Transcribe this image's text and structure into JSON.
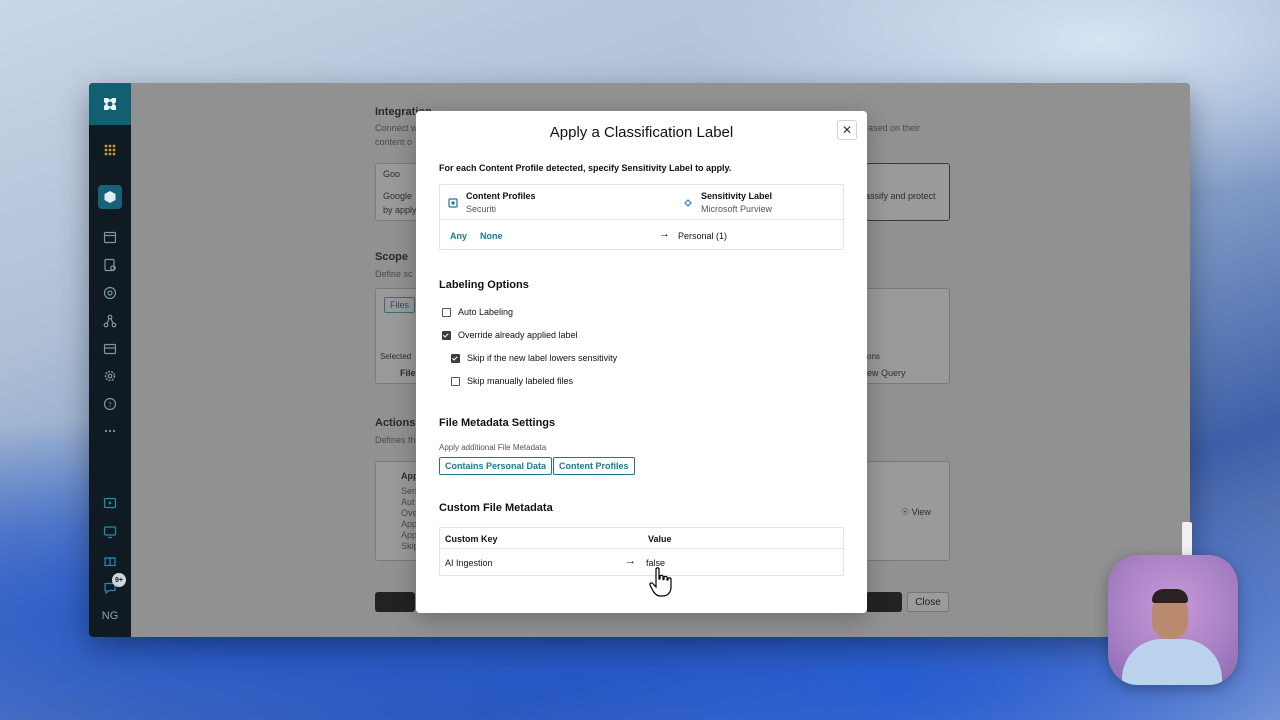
{
  "background": {
    "rail": {
      "avatar": "NG",
      "badge": "9+"
    },
    "integration": {
      "title": "Integration",
      "sub1": "Connect w",
      "sub2": "content o",
      "sub_right": "ased on their",
      "card_title": "Goo",
      "card_line1": "Google",
      "card_line2": "by apply",
      "card_right": "assify and protect"
    },
    "scope": {
      "title": "Scope",
      "sub": "Define sc",
      "chip": "Files",
      "selected": "Selected",
      "file": "File",
      "right_label": "tions",
      "view_query": "iew Query"
    },
    "actions": {
      "title": "Actions",
      "sub": "Defines th",
      "card_title": "App",
      "lines": [
        "Sen",
        "Aut",
        "Ove",
        "App",
        "App",
        "Skip"
      ],
      "view": "View"
    },
    "close_label": "Close"
  },
  "modal": {
    "title": "Apply a Classification Label",
    "intro": "For each Content Profile detected, specify Sensitivity Label to apply.",
    "mapping": {
      "left_header": "Content Profiles",
      "left_sub": "Securiti",
      "right_header": "Sensitivity Label",
      "right_sub": "Microsoft Purview",
      "row_any": "Any",
      "row_none": "None",
      "row_value": "Personal (1)"
    },
    "labeling": {
      "title": "Labeling Options",
      "options": [
        {
          "label": "Auto Labeling",
          "checked": false
        },
        {
          "label": "Override already applied label",
          "checked": true
        },
        {
          "label": "Skip if the new label lowers sensitivity",
          "checked": true
        },
        {
          "label": "Skip manually labeled files",
          "checked": false
        }
      ]
    },
    "file_metadata": {
      "title": "File Metadata Settings",
      "sub": "Apply additional File Metadata",
      "chips": [
        "Contains Personal Data",
        "Content Profiles"
      ]
    },
    "custom_metadata": {
      "title": "Custom File Metadata",
      "key_header": "Custom Key",
      "value_header": "Value",
      "rows": [
        {
          "key": "AI Ingestion",
          "value": "false"
        }
      ]
    }
  }
}
